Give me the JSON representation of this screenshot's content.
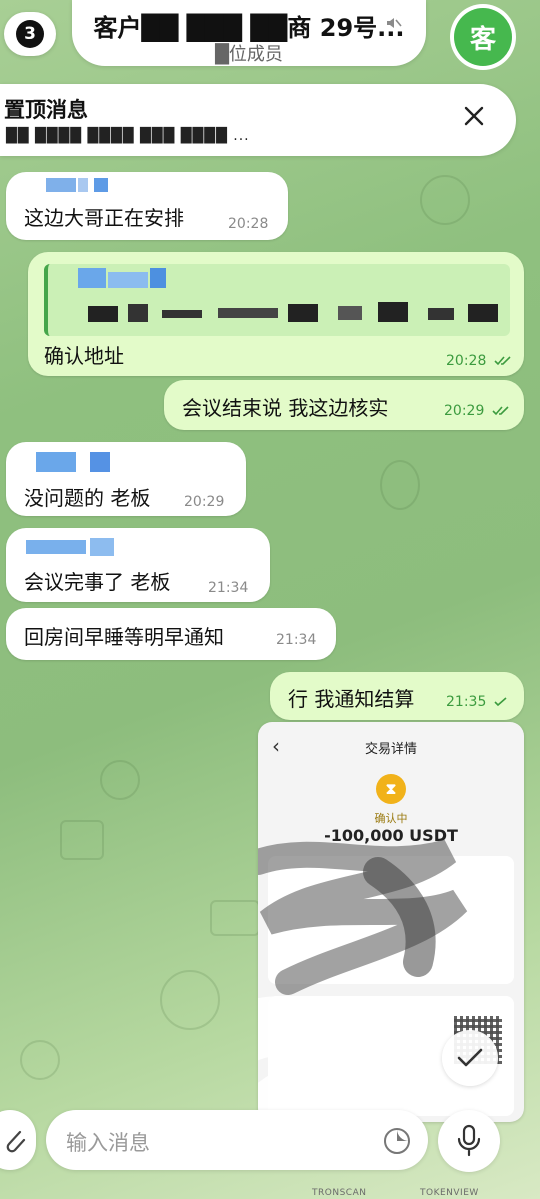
{
  "header": {
    "back_count": "3",
    "title": "客户██ ███ ██商 29号...",
    "subtitle": "█位成员",
    "avatar_letter": "客"
  },
  "pinned": {
    "label": "置顶消息",
    "preview": "██ ████ ████ ███ ████ ..."
  },
  "messages": [
    {
      "text": "这边大哥正在安排",
      "time": "20:28"
    },
    {
      "text": "确认地址",
      "time": "20:28"
    },
    {
      "text": "会议结束说  我这边核实",
      "time": "20:29"
    },
    {
      "text": "没问题的 老板",
      "time": "20:29"
    },
    {
      "text": "会议完事了 老板",
      "time": "21:34"
    },
    {
      "text": "回房间早睡等明早通知",
      "time": "21:34"
    },
    {
      "text": "行 我通知结算",
      "time": "21:35"
    }
  ],
  "transaction": {
    "title": "交易详情",
    "status": "确认中",
    "amount": "-100,000 USDT",
    "footer_left": "TRONSCAN",
    "footer_right": "TOKENVIEW"
  },
  "input": {
    "placeholder": "输入消息"
  },
  "colors": {
    "incoming_bubble": "#ffffff",
    "outgoing_bubble": "#e3fbc9",
    "time_out": "#3c9b3f",
    "avatar_bg": "#46b84e"
  }
}
